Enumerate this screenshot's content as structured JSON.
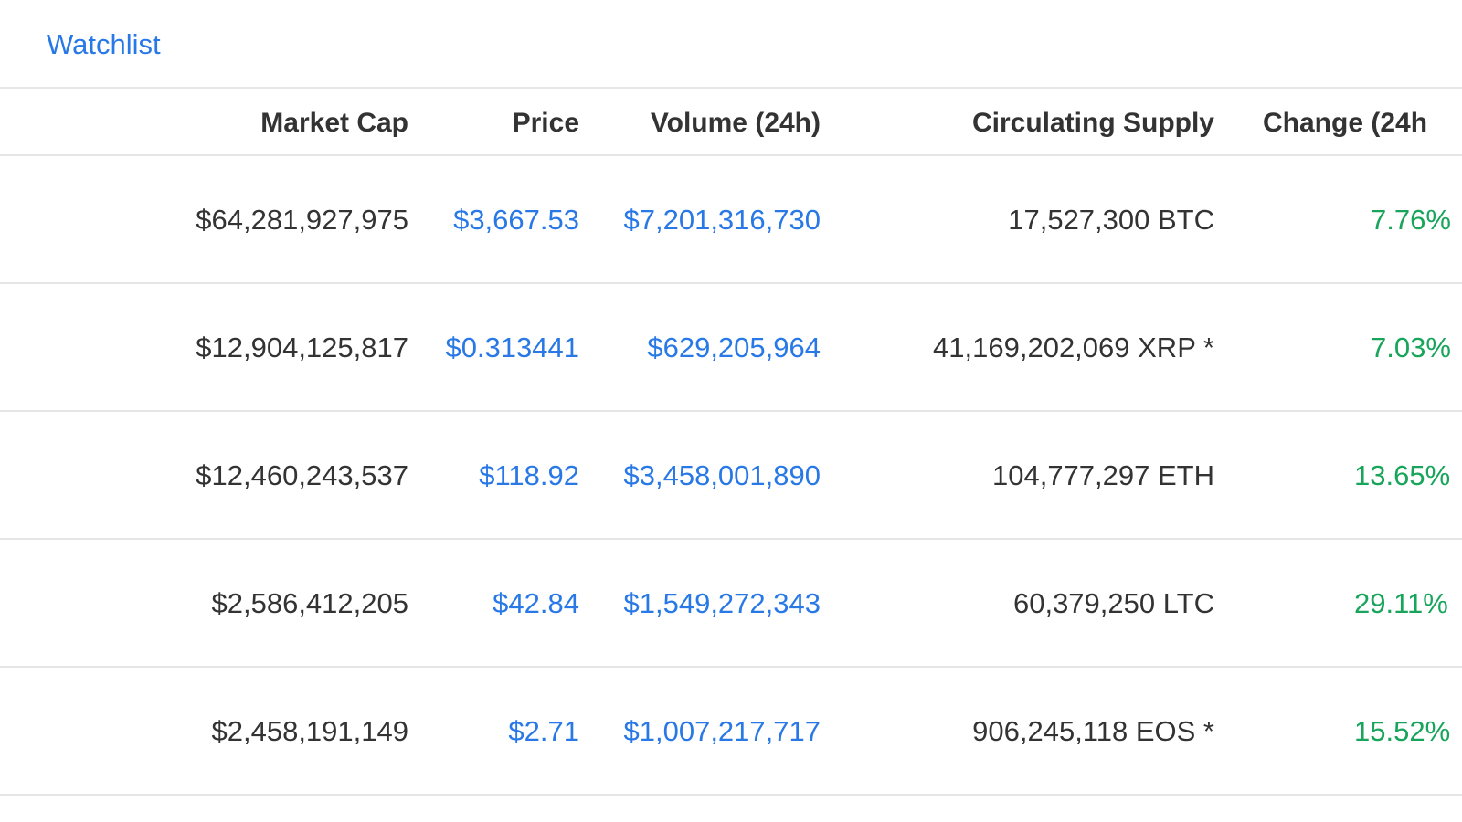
{
  "nav": {
    "watchlist_label": "Watchlist"
  },
  "table": {
    "headers": {
      "market_cap": "Market Cap",
      "price": "Price",
      "volume": "Volume (24h)",
      "supply": "Circulating Supply",
      "change": "Change (24h"
    },
    "rows": [
      {
        "market_cap": "$64,281,927,975",
        "price": "$3,667.53",
        "volume": "$7,201,316,730",
        "supply": "17,527,300 BTC",
        "change": "7.76%"
      },
      {
        "market_cap": "$12,904,125,817",
        "price": "$0.313441",
        "volume": "$629,205,964",
        "supply": "41,169,202,069 XRP *",
        "change": "7.03%"
      },
      {
        "market_cap": "$12,460,243,537",
        "price": "$118.92",
        "volume": "$3,458,001,890",
        "supply": "104,777,297 ETH",
        "change": "13.65%"
      },
      {
        "market_cap": "$2,586,412,205",
        "price": "$42.84",
        "volume": "$1,549,272,343",
        "supply": "60,379,250 LTC",
        "change": "29.11%"
      },
      {
        "market_cap": "$2,458,191,149",
        "price": "$2.71",
        "volume": "$1,007,217,717",
        "supply": "906,245,118 EOS *",
        "change": "15.52%"
      }
    ]
  },
  "colors": {
    "link": "#2878e6",
    "positive": "#18a55b",
    "text": "#333333",
    "divider": "#e6e6e6"
  }
}
